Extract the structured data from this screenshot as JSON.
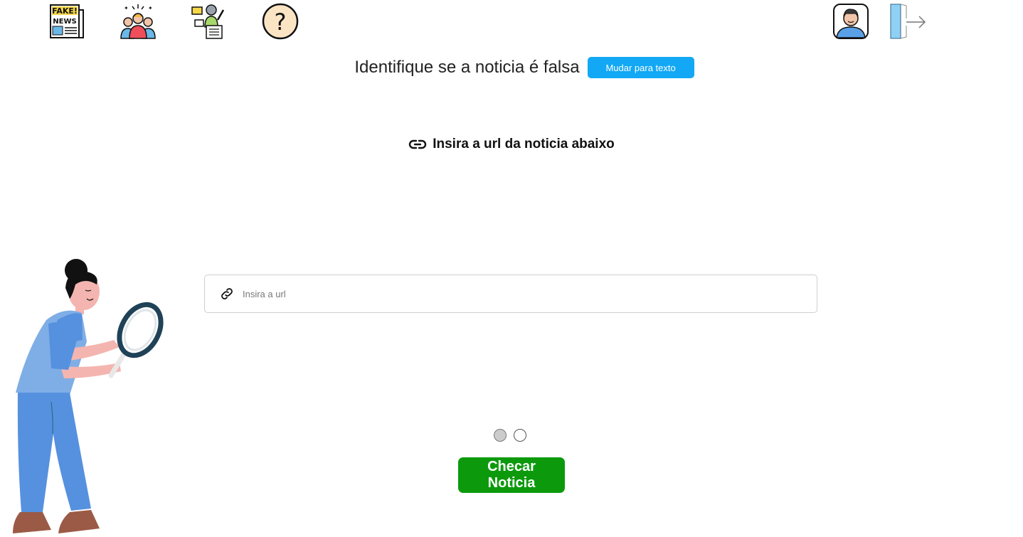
{
  "nav": {
    "icons": [
      "fake-news-icon",
      "community-icon",
      "feedback-icon",
      "help-icon"
    ],
    "user_icon": "user-avatar-icon",
    "logout_icon": "logout-icon"
  },
  "header": {
    "title": "Identifique se a noticia é falsa",
    "switch_label": "Mudar para texto"
  },
  "section": {
    "link_icon": "link-icon",
    "heading": "Insira a url da noticia abaixo"
  },
  "url_field": {
    "placeholder": "Insira a url",
    "value": "",
    "icon": "link-icon"
  },
  "pager": {
    "total": 2,
    "active": 1
  },
  "actions": {
    "check_label": "Checar Noticia"
  },
  "colors": {
    "switch_button": "#12a8f5",
    "check_button": "#0c9a0c"
  }
}
